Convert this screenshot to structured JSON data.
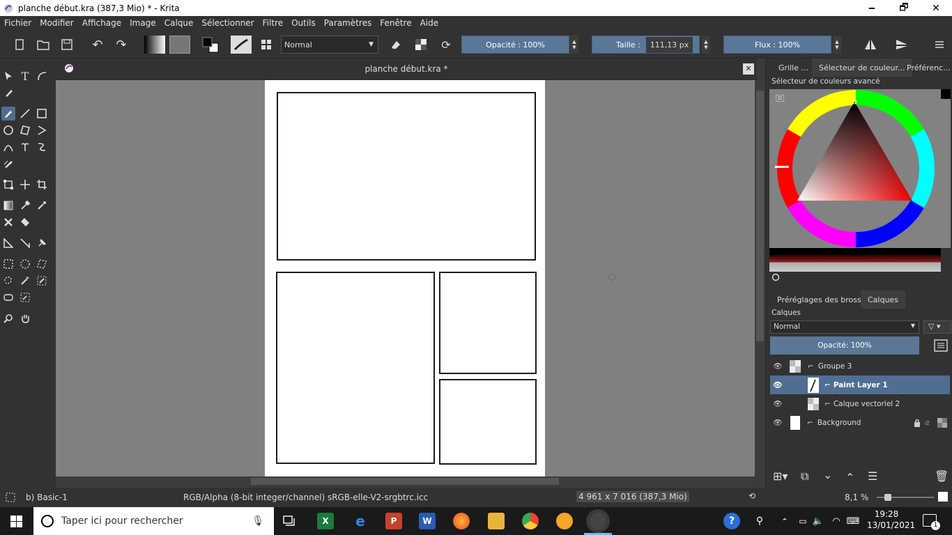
{
  "window": {
    "title": "planche début.kra (387,3 Mio)  * - Krita",
    "minimize": "🗕",
    "maximize": "🗗",
    "close": "✕"
  },
  "menu": [
    "Fichier",
    "Modifier",
    "Affichage",
    "Image",
    "Calque",
    "Sélectionner",
    "Filtre",
    "Outils",
    "Paramètres",
    "Fenêtre",
    "Aide"
  ],
  "toolbar": {
    "blend_mode": "Normal",
    "opacity_label": "Opacité : 100%",
    "size_label": "Taille :",
    "size_value": "111,13 px",
    "flow_label": "Flux : 100%"
  },
  "document": {
    "tab_title": "planche début.kra *",
    "close": "✕"
  },
  "dock": {
    "tabs": [
      "Grille ...",
      "Sélecteur de couleur...",
      "Préférenc..."
    ],
    "color_selector_title": "Sélecteur de couleurs avancé",
    "bottom_tabs": [
      "Préréglages des brosses",
      "Calques"
    ],
    "layers_title": "Calques",
    "layer_blend": "Normal",
    "layer_opacity": "Opacité:  100%",
    "layers": [
      {
        "name": "Groupe 3",
        "selected": false
      },
      {
        "name": "Paint Layer 1",
        "selected": true
      },
      {
        "name": "Calque vectoriel 2",
        "selected": false
      },
      {
        "name": "Background",
        "selected": false
      }
    ]
  },
  "status": {
    "brush": "b) Basic-1",
    "colorspace": "RGB/Alpha (8-bit integer/channel)  sRGB-elle-V2-srgbtrc.icc",
    "dimensions": "4 961 x 7 016 (387,3 Mio)",
    "zoom": "8,1 %",
    "zoom_level": 0.08
  },
  "taskbar": {
    "search_placeholder": "Taper ici pour rechercher",
    "time": "19:28",
    "date": "13/01/2021",
    "notifications": "1"
  }
}
